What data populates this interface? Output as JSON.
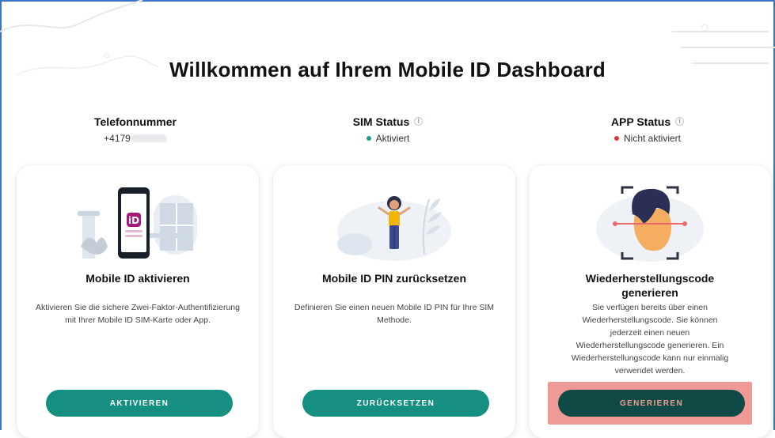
{
  "page": {
    "title": "Willkommen auf Ihrem Mobile ID Dashboard"
  },
  "status": {
    "phone": {
      "label": "Telefonnummer",
      "value": "+4179"
    },
    "sim": {
      "label": "SIM Status",
      "value": "Aktiviert",
      "color": "#1a9e91"
    },
    "app": {
      "label": "APP Status",
      "value": "Nicht aktiviert",
      "color": "#d93a3a"
    }
  },
  "cards": [
    {
      "title": "Mobile ID aktivieren",
      "description": "Aktivieren Sie die sichere Zwei-Faktor-Authentifizierung mit Ihrer Mobile ID SIM-Karte oder App.",
      "button": "AKTIVIEREN"
    },
    {
      "title": "Mobile ID PIN zurücksetzen",
      "description": "Definieren Sie einen neuen Mobile ID PIN für Ihre SIM Methode.",
      "button": "ZURÜCKSETZEN"
    },
    {
      "title": "Wiederherstellungscode generieren",
      "description": "Sie verfügen bereits über einen Wiederherstellungscode. Sie können jederzeit einen neuen Wiederherstellungscode generieren. Ein Wiederherstellungscode kann nur einmalig verwendet werden.",
      "button": "GENERIEREN"
    }
  ],
  "colors": {
    "accent": "#168f83",
    "accent_dark": "#0f4a46",
    "highlight": "#ef9a96",
    "frame": "#3b73c8"
  }
}
